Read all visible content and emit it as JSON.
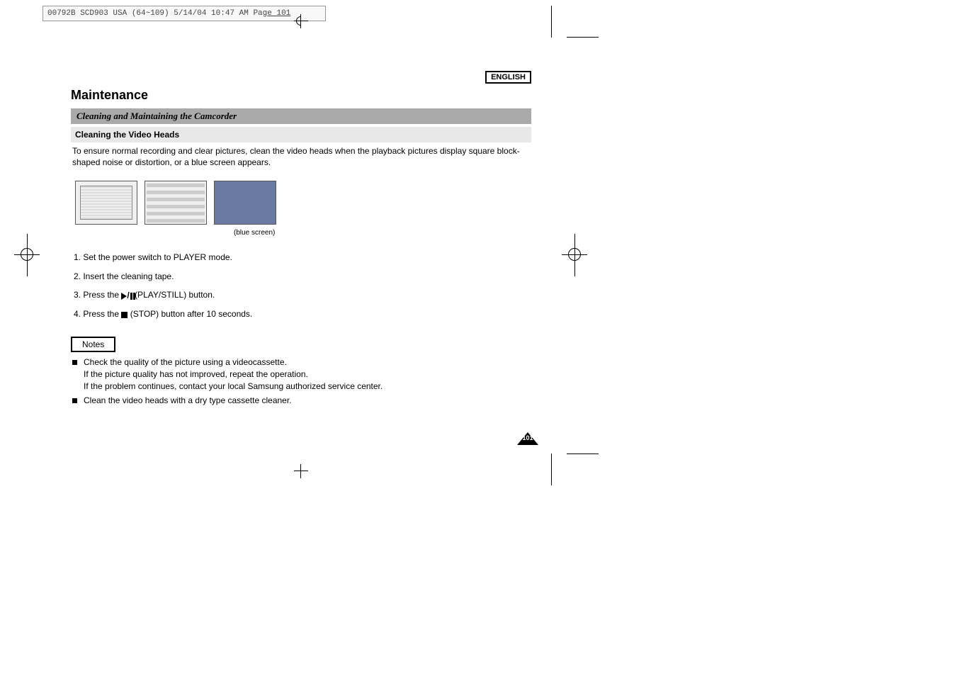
{
  "header_slug": {
    "text_a": "00792B SCD903 USA (64~109)  5/14/04 10:47 AM  Pag",
    "text_b": "e 101"
  },
  "language_badge": "ENGLISH",
  "title": "Maintenance",
  "section_heading": "Cleaning and Maintaining the Camcorder",
  "sub_heading": "Cleaning the Video Heads",
  "intro_text": "To ensure normal recording and clear pictures, clean the video heads when the playback pictures display square block-shaped noise or distortion, or a blue screen appears.",
  "blue_screen_caption": "(blue screen)",
  "steps": {
    "s1": "1.  Set the power switch to PLAYER mode.",
    "s2": "2.  Insert the cleaning tape.",
    "s3a": "3.  Press the ",
    "s3b": "(PLAY/STILL) button.",
    "s4a": "4.  Press the ",
    "s4b": "(STOP) button after 10 seconds."
  },
  "notes_label": "Notes",
  "notes": {
    "n1_l1": "Check the quality of the picture using a videocassette.",
    "n1_l2": "If the picture quality has not improved, repeat the operation.",
    "n1_l3": "If the problem continues, contact your local Samsung authorized service center.",
    "n2": "Clean the video heads with a dry type cassette cleaner."
  },
  "page_number": "101"
}
